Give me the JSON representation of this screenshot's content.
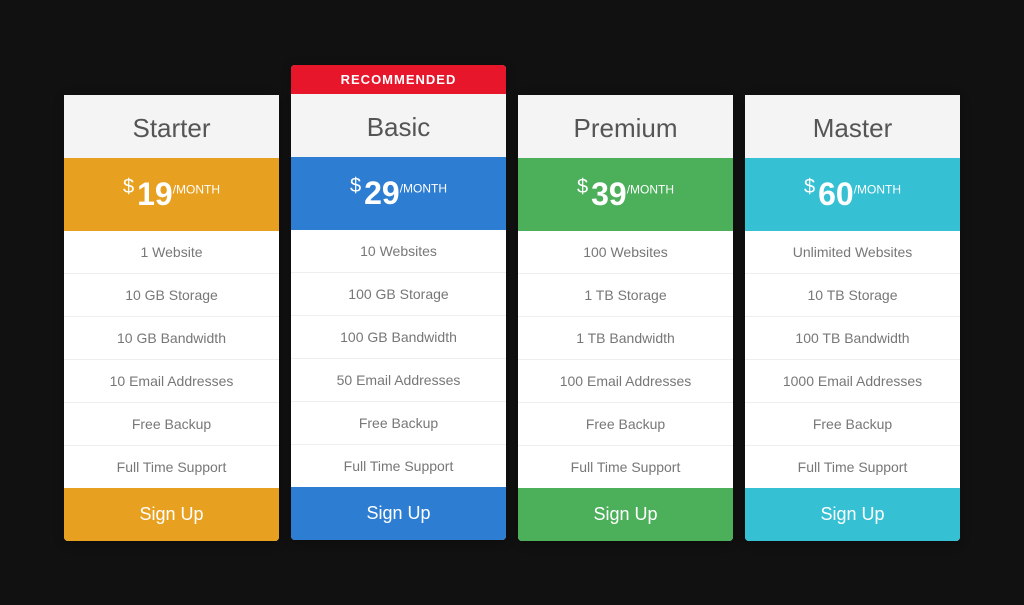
{
  "plans": [
    {
      "id": "starter",
      "recommended": false,
      "title": "Starter",
      "price": "19",
      "price_color": "price-orange",
      "btn_color": "btn-orange",
      "features": [
        "1 Website",
        "10 GB Storage",
        "10 GB Bandwidth",
        "10 Email Addresses",
        "Free Backup",
        "Full Time Support"
      ],
      "btn_label": "Sign Up"
    },
    {
      "id": "basic",
      "recommended": true,
      "recommended_label": "RECOMMENDED",
      "title": "Basic",
      "price": "29",
      "price_color": "price-blue",
      "btn_color": "btn-blue",
      "features": [
        "10 Websites",
        "100 GB Storage",
        "100 GB Bandwidth",
        "50 Email Addresses",
        "Free Backup",
        "Full Time Support"
      ],
      "btn_label": "Sign Up"
    },
    {
      "id": "premium",
      "recommended": false,
      "title": "Premium",
      "price": "39",
      "price_color": "price-green",
      "btn_color": "btn-green",
      "features": [
        "100 Websites",
        "1 TB Storage",
        "1 TB Bandwidth",
        "100 Email Addresses",
        "Free Backup",
        "Full Time Support"
      ],
      "btn_label": "Sign Up"
    },
    {
      "id": "master",
      "recommended": false,
      "title": "Master",
      "price": "60",
      "price_color": "price-teal",
      "btn_color": "btn-teal",
      "features": [
        "Unlimited Websites",
        "10 TB Storage",
        "100 TB Bandwidth",
        "1000 Email Addresses",
        "Free Backup",
        "Full Time Support"
      ],
      "btn_label": "Sign Up"
    }
  ],
  "currency_symbol": "$",
  "per_month_label": "/MONTH"
}
